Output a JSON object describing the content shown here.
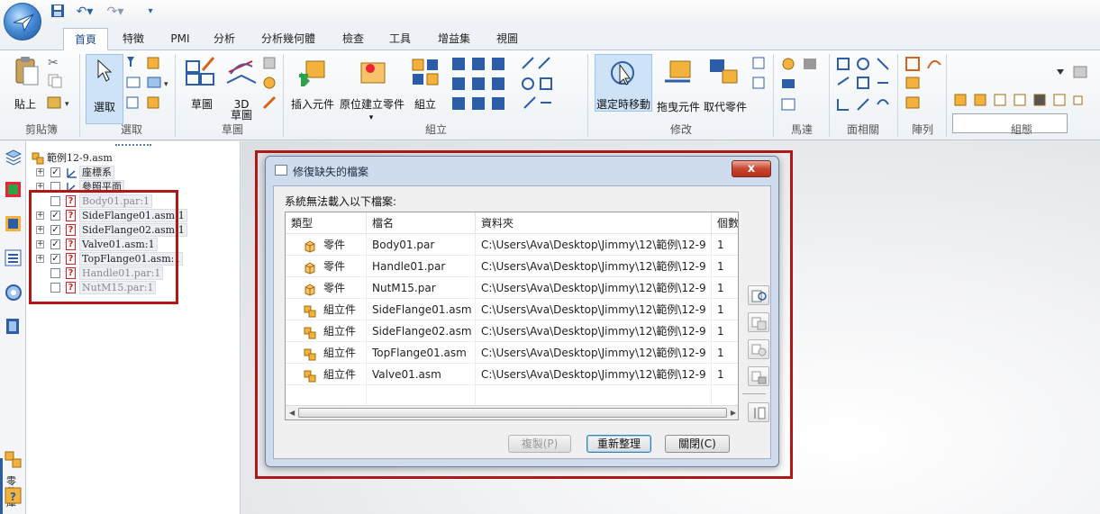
{
  "quick_access": {
    "icons": [
      "save-icon",
      "undo-icon",
      "redo-icon",
      "customize-icon"
    ]
  },
  "ribbon": {
    "tabs": [
      "首頁",
      "特徵",
      "PMI",
      "分析",
      "分析幾何體",
      "檢查",
      "工具",
      "增益集",
      "視圖"
    ],
    "active_tab": "首頁",
    "groups": {
      "clipboard": "剪貼簿",
      "select": "選取",
      "sketch": "草圖",
      "assemble": "組立",
      "modify": "修改",
      "motor": "馬達",
      "face_relate": "面相關",
      "pattern": "陣列",
      "configure": "組態"
    },
    "buttons": {
      "paste": "貼上",
      "select": "選取",
      "sketch": "草圖",
      "sketch3d_line1": "3D",
      "sketch3d_line2": "草圖",
      "insert_component": "插入元件",
      "create_in_place": "原位建立零件",
      "assemble": "組立",
      "select_move": "選定時移動",
      "drag_component": "拖曳元件",
      "replace_component": "取代零件"
    },
    "configure_combo_value": ""
  },
  "leftbar": {
    "vertical_label": "零件庫"
  },
  "tree": {
    "root": "範例12-9.asm",
    "items": [
      {
        "label": "座標系",
        "expand": "+",
        "checked": "✓",
        "missing": false,
        "gray": false
      },
      {
        "label": "參照平面",
        "expand": "+",
        "checked": "",
        "missing": false,
        "gray": false
      },
      {
        "label": "Body01.par:1",
        "expand": "",
        "checked": "",
        "missing": true,
        "gray": true
      },
      {
        "label": "SideFlange01.asm:1",
        "expand": "+",
        "checked": "✓",
        "missing": true,
        "gray": false
      },
      {
        "label": "SideFlange02.asm:1",
        "expand": "+",
        "checked": "✓",
        "missing": true,
        "gray": false
      },
      {
        "label": "Valve01.asm:1",
        "expand": "+",
        "checked": "✓",
        "missing": true,
        "gray": false
      },
      {
        "label": "TopFlange01.asm:1",
        "expand": "+",
        "checked": "✓",
        "missing": true,
        "gray": false
      },
      {
        "label": "Handle01.par:1",
        "expand": "",
        "checked": "",
        "missing": true,
        "gray": true
      },
      {
        "label": "NutM15.par:1",
        "expand": "",
        "checked": "",
        "missing": true,
        "gray": true
      }
    ]
  },
  "dialog": {
    "title": "修復缺失的檔案",
    "close_glyph": "x",
    "message": "系統無法載入以下檔案:",
    "columns": [
      "類型",
      "檔名",
      "資料夾",
      "個數"
    ],
    "rows": [
      {
        "type": "零件",
        "kind": "part",
        "name": "Body01.par",
        "folder": "C:\\Users\\Ava\\Desktop\\Jimmy\\12\\範例\\12-9",
        "count": "1"
      },
      {
        "type": "零件",
        "kind": "part",
        "name": "Handle01.par",
        "folder": "C:\\Users\\Ava\\Desktop\\Jimmy\\12\\範例\\12-9",
        "count": "1"
      },
      {
        "type": "零件",
        "kind": "part",
        "name": "NutM15.par",
        "folder": "C:\\Users\\Ava\\Desktop\\Jimmy\\12\\範例\\12-9",
        "count": "1"
      },
      {
        "type": "組立件",
        "kind": "asm",
        "name": "SideFlange01.asm",
        "folder": "C:\\Users\\Ava\\Desktop\\Jimmy\\12\\範例\\12-9",
        "count": "1"
      },
      {
        "type": "組立件",
        "kind": "asm",
        "name": "SideFlange02.asm",
        "folder": "C:\\Users\\Ava\\Desktop\\Jimmy\\12\\範例\\12-9",
        "count": "1"
      },
      {
        "type": "組立件",
        "kind": "asm",
        "name": "TopFlange01.asm",
        "folder": "C:\\Users\\Ava\\Desktop\\Jimmy\\12\\範例\\12-9",
        "count": "1"
      },
      {
        "type": "組立件",
        "kind": "asm",
        "name": "Valve01.asm",
        "folder": "C:\\Users\\Ava\\Desktop\\Jimmy\\12\\範例\\12-9",
        "count": "1"
      }
    ],
    "buttons": {
      "copy": "複製(P)",
      "refresh": "重新整理",
      "close": "關閉(C)"
    }
  },
  "colors": {
    "accent": "#2c5ea8",
    "highlight_frame": "#b01818",
    "ribbon_selected": "#cfe3f8"
  }
}
